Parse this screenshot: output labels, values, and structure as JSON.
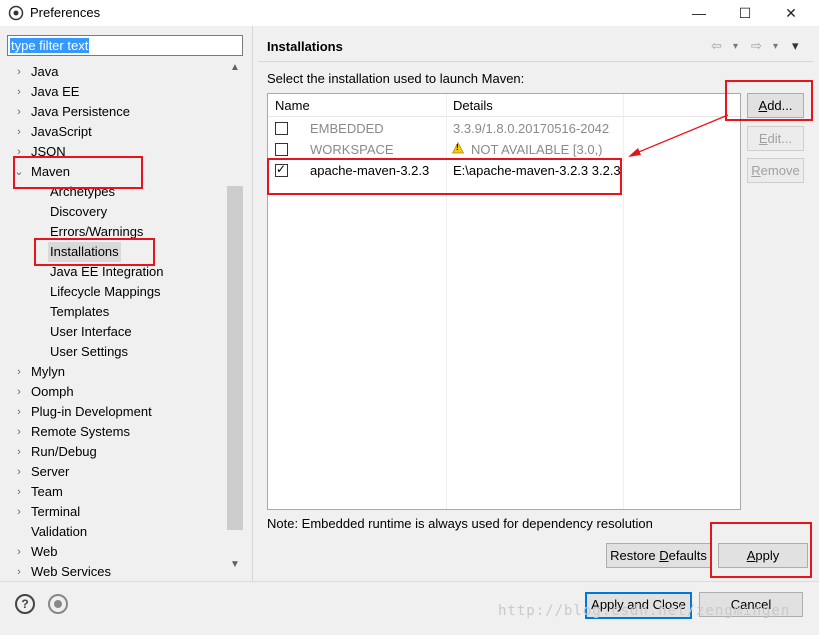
{
  "window": {
    "title": "Preferences",
    "minimize_glyph": "—",
    "maximize_glyph": "☐",
    "close_glyph": "✕"
  },
  "filter": {
    "value": "type filter text"
  },
  "tree": [
    {
      "label": "Java",
      "expander": "›"
    },
    {
      "label": "Java EE",
      "expander": "›"
    },
    {
      "label": "Java Persistence",
      "expander": "›"
    },
    {
      "label": "JavaScript",
      "expander": "›"
    },
    {
      "label": "JSON",
      "expander": "›"
    },
    {
      "label": "Maven",
      "expander": "⌄"
    },
    {
      "label": "Archetypes"
    },
    {
      "label": "Discovery"
    },
    {
      "label": "Errors/Warnings"
    },
    {
      "label": "Installations"
    },
    {
      "label": "Java EE Integration"
    },
    {
      "label": "Lifecycle Mappings"
    },
    {
      "label": "Templates"
    },
    {
      "label": "User Interface"
    },
    {
      "label": "User Settings"
    },
    {
      "label": "Mylyn",
      "expander": "›"
    },
    {
      "label": "Oomph",
      "expander": "›"
    },
    {
      "label": "Plug-in Development",
      "expander": "›"
    },
    {
      "label": "Remote Systems",
      "expander": "›"
    },
    {
      "label": "Run/Debug",
      "expander": "›"
    },
    {
      "label": "Server",
      "expander": "›"
    },
    {
      "label": "Team",
      "expander": "›"
    },
    {
      "label": "Terminal",
      "expander": "›"
    },
    {
      "label": "Validation"
    },
    {
      "label": "Web",
      "expander": "›"
    },
    {
      "label": "Web Services",
      "expander": "›"
    }
  ],
  "page": {
    "title": "Installations",
    "instruction": "Select the installation used to launch Maven:",
    "note": "Note: Embedded runtime is always used for dependency resolution"
  },
  "table": {
    "columns": [
      "Name",
      "Details"
    ],
    "rows": [
      {
        "name": "EMBEDDED",
        "details": "3.3.9/1.8.0.20170516-2042",
        "checked": false,
        "disabled": true
      },
      {
        "name": "WORKSPACE",
        "details": "NOT AVAILABLE [3.0,)",
        "checked": false,
        "disabled": true,
        "warning": true
      },
      {
        "name": "apache-maven-3.2.3",
        "details": "E:\\apache-maven-3.2.3 3.2.3",
        "checked": true,
        "disabled": false
      }
    ]
  },
  "buttons": {
    "add": "Add...",
    "edit": "Edit...",
    "remove": "Remove",
    "restore_defaults": "Restore Defaults",
    "apply": "Apply",
    "apply_and_close": "Apply and Close",
    "cancel": "Cancel"
  },
  "icons": {
    "help": "?",
    "check": "✓",
    "warning": "!",
    "nav_back": "⇦",
    "nav_forward": "⇨",
    "dropdown": "▾",
    "scroll_up": "▲",
    "scroll_down": "▼"
  },
  "watermark": "http://blog.csdn.net/zengmingen",
  "colors": {
    "accent": "#0078d7",
    "highlight_box": "#e8141c",
    "selection": "#3399ff"
  }
}
